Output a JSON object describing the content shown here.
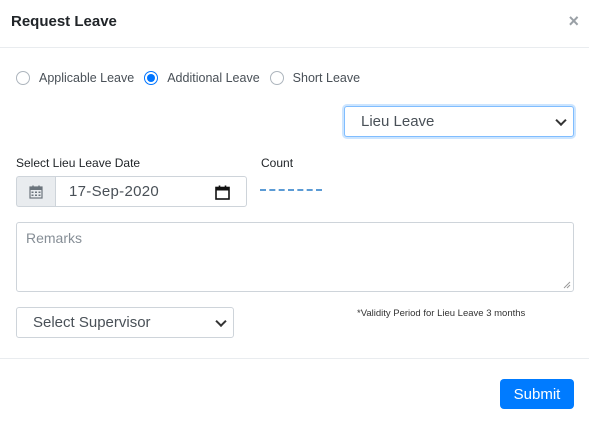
{
  "modal": {
    "title": "Request Leave",
    "close_label": "×"
  },
  "leave_options": [
    {
      "label": "Applicable Leave",
      "checked": false
    },
    {
      "label": "Additional Leave",
      "checked": true
    },
    {
      "label": "Short Leave",
      "checked": false
    }
  ],
  "leave_type_select": {
    "selected": "Lieu Leave"
  },
  "date_field": {
    "label": "Select Lieu Leave Date",
    "value": "17-Sep-2020"
  },
  "count": {
    "label": "Count"
  },
  "remarks": {
    "placeholder": "Remarks"
  },
  "supervisor_select": {
    "selected": "Select Supervisor"
  },
  "validity_note": "*Validity Period for Lieu Leave 3 months",
  "footer": {
    "submit_label": "Submit"
  },
  "colors": {
    "accent": "#007bff",
    "radio_checked": "#0075ff",
    "count_line": "#5b9bd5"
  }
}
